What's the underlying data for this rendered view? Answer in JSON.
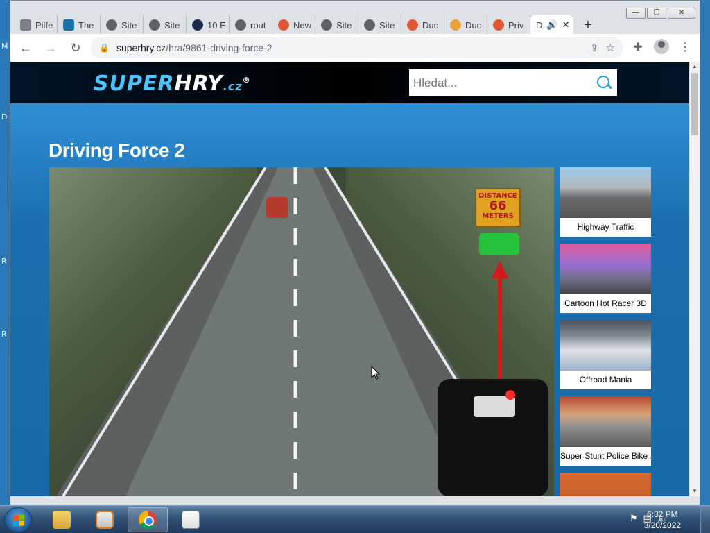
{
  "desktop": {
    "left_letters": [
      "M",
      "D",
      "R",
      "R"
    ]
  },
  "window_controls": {
    "minimize": "—",
    "restore": "❐",
    "close": "✕"
  },
  "tabs": [
    {
      "label": "Pilfe",
      "color": "#7b7f85"
    },
    {
      "label": "The",
      "color": "#1b6fa8"
    },
    {
      "label": "Site",
      "color": "#5f6368"
    },
    {
      "label": "Site",
      "color": "#5f6368"
    },
    {
      "label": "10 E",
      "color": "#1a2a4a"
    },
    {
      "label": "rout",
      "color": "#5f6368"
    },
    {
      "label": "New",
      "color": "#de5833"
    },
    {
      "label": "Site",
      "color": "#5f6368"
    },
    {
      "label": "Site",
      "color": "#5f6368"
    },
    {
      "label": "Duc",
      "color": "#de5833"
    },
    {
      "label": "Duc",
      "color": "#e8a33d"
    },
    {
      "label": "Priv",
      "color": "#de5833"
    },
    {
      "label": "D",
      "active": true
    }
  ],
  "toolbar": {
    "url_host": "superhry.cz",
    "url_path": "/hra/9861-driving-force-2"
  },
  "site": {
    "logo_part1": "SUPER",
    "logo_part2": "HRY",
    "logo_part3": ".cz",
    "logo_reg": "®",
    "search_placeholder": "Hledat..."
  },
  "page": {
    "title": "Driving Force 2"
  },
  "game": {
    "distance_label": "DISTANCE",
    "distance_value": "66",
    "distance_unit": "METERS"
  },
  "related_games": [
    {
      "label": "Highway Traffic"
    },
    {
      "label": "Cartoon Hot Racer 3D"
    },
    {
      "label": "Offroad Mania"
    },
    {
      "label": "Super Stunt Police Bike ..."
    },
    {
      "label": ""
    }
  ],
  "taskbar": {
    "time": "6:32 PM",
    "date": "3/20/2022"
  }
}
